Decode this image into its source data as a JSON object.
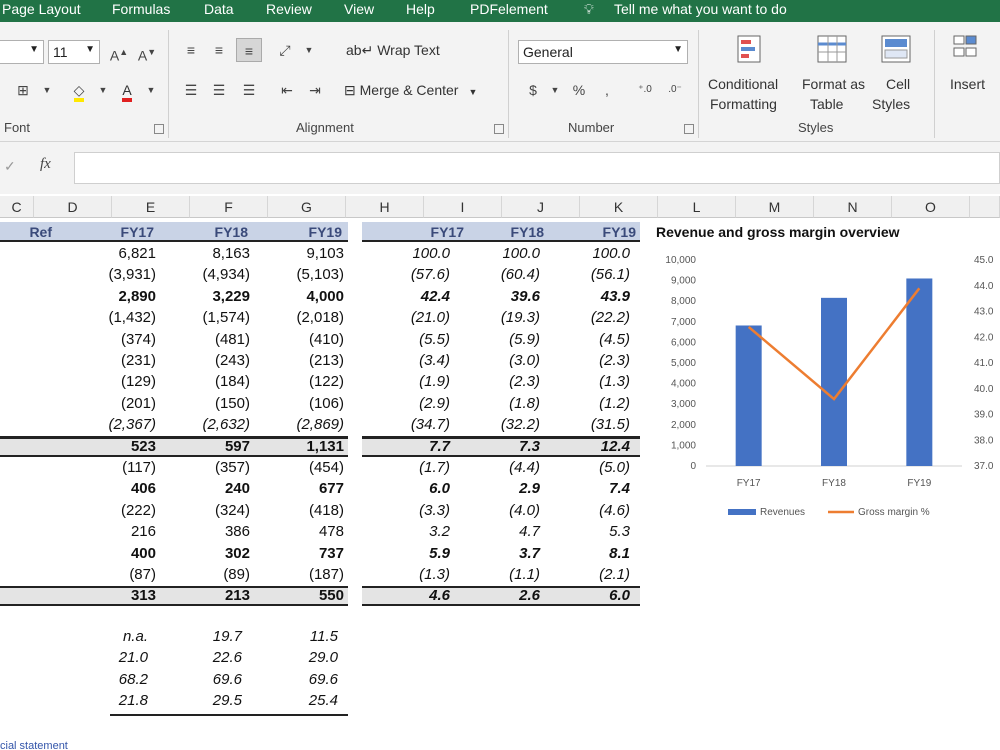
{
  "menu": [
    "Page Layout",
    "Formulas",
    "Data",
    "Review",
    "View",
    "Help",
    "PDFelement",
    "Tell me what you want to do"
  ],
  "ribbon": {
    "font": {
      "size": "11",
      "label": "Font"
    },
    "alignment": {
      "wrap_text": "Wrap Text",
      "merge_center": "Merge & Center",
      "label": "Alignment"
    },
    "number": {
      "format": "General",
      "currency": "$",
      "percent": "%",
      "comma": ",",
      "label": "Number"
    },
    "styles": {
      "conditional_1": "Conditional",
      "conditional_2": "Formatting",
      "format_as_1": "Format as",
      "format_as_2": "Table",
      "cell_styles_1": "Cell",
      "cell_styles_2": "Styles",
      "label": "Styles"
    },
    "insert": "Insert"
  },
  "formula_bar": {
    "fx": "fx",
    "check": "✓"
  },
  "columns": [
    "D",
    "E",
    "F",
    "G",
    "H",
    "I",
    "J",
    "K",
    "L",
    "M",
    "N",
    "O"
  ],
  "table_headers": {
    "ref": "Ref",
    "left": [
      "FY17",
      "FY18",
      "FY19"
    ],
    "right": [
      "FY17",
      "FY18",
      "FY19"
    ]
  },
  "rows": [
    {
      "left": [
        "6,821",
        "8,163",
        "9,103"
      ],
      "right": [
        "100.0",
        "100.0",
        "100.0"
      ],
      "bold": false
    },
    {
      "left": [
        "(3,931)",
        "(4,934)",
        "(5,103)"
      ],
      "right": [
        "(57.6)",
        "(60.4)",
        "(56.1)"
      ],
      "bold": false
    },
    {
      "left": [
        "2,890",
        "3,229",
        "4,000"
      ],
      "right": [
        "42.4",
        "39.6",
        "43.9"
      ],
      "bold": true
    },
    {
      "left": [
        "(1,432)",
        "(1,574)",
        "(2,018)"
      ],
      "right": [
        "(21.0)",
        "(19.3)",
        "(22.2)"
      ],
      "bold": false
    },
    {
      "left": [
        "(374)",
        "(481)",
        "(410)"
      ],
      "right": [
        "(5.5)",
        "(5.9)",
        "(4.5)"
      ],
      "bold": false
    },
    {
      "left": [
        "(231)",
        "(243)",
        "(213)"
      ],
      "right": [
        "(3.4)",
        "(3.0)",
        "(2.3)"
      ],
      "bold": false
    },
    {
      "left": [
        "(129)",
        "(184)",
        "(122)"
      ],
      "right": [
        "(1.9)",
        "(2.3)",
        "(1.3)"
      ],
      "bold": false
    },
    {
      "left": [
        "(201)",
        "(150)",
        "(106)"
      ],
      "right": [
        "(2.9)",
        "(1.8)",
        "(1.2)"
      ],
      "bold": false
    },
    {
      "left": [
        "(2,367)",
        "(2,632)",
        "(2,869)"
      ],
      "right": [
        "(34.7)",
        "(32.2)",
        "(31.5)"
      ],
      "bold": false
    },
    {
      "left": [
        "523",
        "597",
        "1,131"
      ],
      "right": [
        "7.7",
        "7.3",
        "12.4"
      ],
      "bold": true
    },
    {
      "left": [
        "(117)",
        "(357)",
        "(454)"
      ],
      "right": [
        "(1.7)",
        "(4.4)",
        "(5.0)"
      ],
      "bold": false
    },
    {
      "left": [
        "406",
        "240",
        "677"
      ],
      "right": [
        "6.0",
        "2.9",
        "7.4"
      ],
      "bold": true
    },
    {
      "left": [
        "(222)",
        "(324)",
        "(418)"
      ],
      "right": [
        "(3.3)",
        "(4.0)",
        "(4.6)"
      ],
      "bold": false
    },
    {
      "left": [
        "216",
        "386",
        "478"
      ],
      "right": [
        "3.2",
        "4.7",
        "5.3"
      ],
      "bold": false
    },
    {
      "left": [
        "400",
        "302",
        "737"
      ],
      "right": [
        "5.9",
        "3.7",
        "8.1"
      ],
      "bold": true
    },
    {
      "left": [
        "(87)",
        "(89)",
        "(187)"
      ],
      "right": [
        "(1.3)",
        "(1.1)",
        "(2.1)"
      ],
      "bold": false
    },
    {
      "left": [
        "313",
        "213",
        "550"
      ],
      "right": [
        "4.6",
        "2.6",
        "6.0"
      ],
      "bold": true
    }
  ],
  "ratios": [
    [
      "n.a.",
      "19.7",
      "11.5"
    ],
    [
      "21.0",
      "22.6",
      "29.0"
    ],
    [
      "68.2",
      "69.6",
      "69.6"
    ],
    [
      "21.8",
      "29.5",
      "25.4"
    ]
  ],
  "footer_link": "cial statement",
  "chart_data": {
    "type": "bar",
    "title": "Revenue and gross margin overview",
    "categories": [
      "FY17",
      "FY18",
      "FY19"
    ],
    "series": [
      {
        "name": "Revenues",
        "type": "bar",
        "axis": "left",
        "values": [
          6821,
          8163,
          9103
        ],
        "color": "#4472c4"
      },
      {
        "name": "Gross margin %",
        "type": "line",
        "axis": "right",
        "values": [
          42.4,
          39.6,
          43.9
        ],
        "color": "#ed7d31"
      }
    ],
    "y_left": {
      "min": 0,
      "max": 10000,
      "ticks": [
        "0",
        "1,000",
        "2,000",
        "3,000",
        "4,000",
        "5,000",
        "6,000",
        "7,000",
        "8,000",
        "9,000",
        "10,000"
      ]
    },
    "y_right": {
      "min": 37.0,
      "max": 45.0,
      "ticks": [
        "37.0",
        "38.0",
        "39.0",
        "40.0",
        "41.0",
        "42.0",
        "43.0",
        "44.0",
        "45.0"
      ]
    },
    "legend": "bottom"
  }
}
